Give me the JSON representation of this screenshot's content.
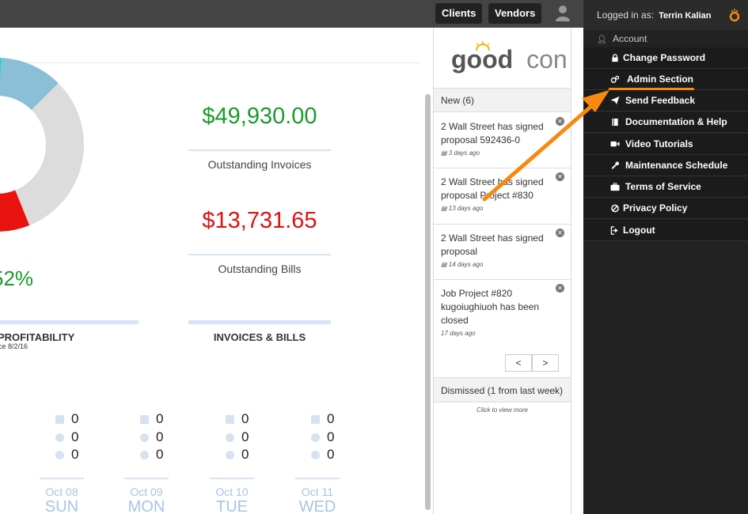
{
  "topbar": {
    "clients_label": "Clients",
    "vendors_label": "Vendors",
    "user_icon": "user-icon"
  },
  "dashboard": {
    "outstanding_invoices_amount": "$49,930.00",
    "outstanding_invoices_label": "Outstanding Invoices",
    "outstanding_bills_amount": "$13,731.65",
    "outstanding_bills_label": "Outstanding Bills",
    "profit_percent": "52%",
    "profitability_title": "PROFITABILITY",
    "profitability_sub": "ce 8/2/16",
    "invoices_bills_title": "INVOICES & BILLS",
    "donut": {
      "segments": [
        {
          "name": "teal",
          "color": "#17cfc9"
        },
        {
          "name": "light-blue",
          "color": "#8bbfd6"
        },
        {
          "name": "gray",
          "color": "#dcdcdc"
        },
        {
          "name": "red",
          "color": "#e8130f"
        }
      ]
    },
    "days": [
      {
        "date": "Oct 08",
        "day": "SUN",
        "docs": "0",
        "locations": "0",
        "people": "0"
      },
      {
        "date": "Oct 09",
        "day": "MON",
        "docs": "0",
        "locations": "0",
        "people": "0"
      },
      {
        "date": "Oct 10",
        "day": "TUE",
        "docs": "0",
        "locations": "0",
        "people": "0"
      },
      {
        "date": "Oct 11",
        "day": "WED",
        "docs": "0",
        "locations": "0",
        "people": "0"
      }
    ]
  },
  "notifications": {
    "logo_left": "good",
    "logo_right": "con",
    "new_header": "New (6)",
    "items": [
      {
        "text": "2 Wall Street has signed proposal 592436-0",
        "time": "3 days ago"
      },
      {
        "text": "2 Wall Street has signed proposal Project #830",
        "time": "13 days ago"
      },
      {
        "text": "2 Wall Street has signed proposal",
        "time": "14 days ago"
      },
      {
        "text": "Job Project #820 kugoiughiuoh has been closed",
        "time": "17 days ago"
      }
    ],
    "prev_label": "<",
    "next_label": ">",
    "dismissed_header": "Dismissed (1 from last week)",
    "view_more": "Click to view more"
  },
  "sidebar": {
    "logged_in_label": "Logged in as:",
    "user_name": "Terrin Kalian",
    "account_label": "Account",
    "items": [
      {
        "label": "Change Password",
        "icon": "lock-icon"
      },
      {
        "label": "Admin Section",
        "icon": "gears-icon"
      },
      {
        "label": "Send Feedback",
        "icon": "paper-plane-icon"
      },
      {
        "label": "Documentation & Help",
        "icon": "book-icon"
      },
      {
        "label": "Video Tutorials",
        "icon": "video-camera-icon"
      },
      {
        "label": "Maintenance Schedule",
        "icon": "wrench-icon"
      },
      {
        "label": "Terms of Service",
        "icon": "briefcase-icon"
      },
      {
        "label": "Privacy Policy",
        "icon": "ban-icon"
      },
      {
        "label": "Logout",
        "icon": "sign-out-icon"
      }
    ]
  },
  "colors": {
    "accent_orange": "#f7890f",
    "positive_green": "#1a9b2c",
    "negative_red": "#e01010",
    "sidebar_bg": "#222222"
  }
}
